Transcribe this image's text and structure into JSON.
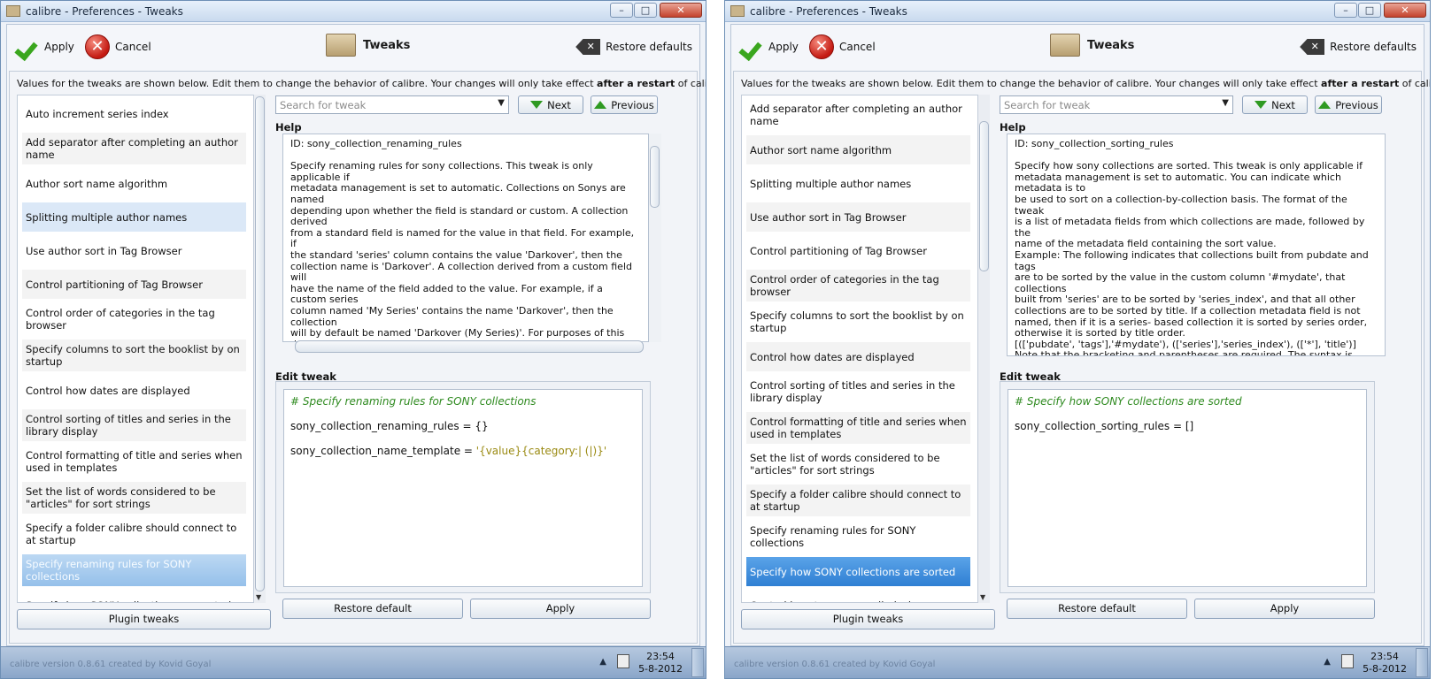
{
  "windows": [
    {
      "title": "calibre - Preferences - Tweaks",
      "toolbar": {
        "apply": "Apply",
        "cancel": "Cancel",
        "title": "Tweaks",
        "restore": "Restore defaults"
      },
      "description": {
        "before": "Values for the tweaks are shown below. Edit them to change the behavior of calibre. Your changes will only take effect ",
        "bold": "after a restart",
        "after": " of calibre."
      },
      "list": [
        "Auto increment series index",
        "Add separator after completing an author name",
        "Author sort name algorithm",
        "Splitting multiple author names",
        "Use author sort in Tag Browser",
        "Control partitioning of Tag Browser",
        "Control order of categories in the tag browser",
        "Specify columns to sort the booklist by on startup",
        "Control how dates are displayed",
        "Control sorting of titles and series in the library display",
        "Control formatting of title and series when used in templates",
        "Set the list of words considered to be \"articles\" for sort strings",
        "Specify a folder calibre should connect to at startup",
        "Specify renaming rules for SONY collections",
        "Specify how SONY collections are sorted"
      ],
      "search_placeholder": "Search for tweak",
      "next": "Next",
      "previous": "Previous",
      "help_label": "Help",
      "help_text": "ID: sony_collection_renaming_rules\n\nSpecify renaming rules for sony collections. This tweak is only applicable if\nmetadata management is set to automatic. Collections on Sonys are named\ndepending upon whether the field is standard or custom. A collection derived\nfrom a standard field is named for the value in that field. For example, if\nthe standard 'series' column contains the value 'Darkover', then the\ncollection name is 'Darkover'. A collection derived from a custom field will\nhave the name of the field added to the value. For example, if a custom series\ncolumn named 'My Series' contains the name 'Darkover', then the collection\nwill by default be named 'Darkover (My Series)'. For purposes of this\ndocumentation, 'Darkover' is called the value and 'My Series' is called the\ncategory. If two books have fields that generate the same collection name,\nthen both books will be in that collection.\nThis set of tweaks lets you specify for a standard or custom field how\nthe collections are to be named. You can use it to add a description to a\nstandard field, for example 'Foo (Tag)' instead of the 'Foo'. You can also use\nit to force multiple fields to end up in the same collection. For example, you",
      "edit_label": "Edit tweak",
      "edit_comment": "# Specify renaming rules for SONY collections",
      "edit_line1": "sony_collection_renaming_rules = {}",
      "edit_line2_code": "sony_collection_name_template = ",
      "edit_line2_str": "'{value}{category:| (|)}'",
      "plugin_tweaks": "Plugin tweaks",
      "restore_default": "Restore default",
      "apply": "Apply",
      "taskbar_status": "calibre version 0.8.61 created by Kovid Goyal",
      "clock_time": "23:54",
      "clock_date": "5-8-2012"
    },
    {
      "title": "calibre - Preferences - Tweaks",
      "toolbar": {
        "apply": "Apply",
        "cancel": "Cancel",
        "title": "Tweaks",
        "restore": "Restore defaults"
      },
      "description": {
        "before": "Values for the tweaks are shown below. Edit them to change the behavior of calibre. Your changes will only take effect ",
        "bold": "after a restart",
        "after": " of calibre."
      },
      "list": [
        "Add separator after completing an author name",
        "Author sort name algorithm",
        "Splitting multiple author names",
        "Use author sort in Tag Browser",
        "Control partitioning of Tag Browser",
        "Control order of categories in the tag browser",
        "Specify columns to sort the booklist by on startup",
        "Control how dates are displayed",
        "Control sorting of titles and series in the library display",
        "Control formatting of title and series when used in templates",
        "Set the list of words considered to be \"articles\" for sort strings",
        "Specify a folder calibre should connect to at startup",
        "Specify renaming rules for SONY collections",
        "Specify how SONY collections are sorted",
        "Control how tags are applied when"
      ],
      "search_placeholder": "Search for tweak",
      "next": "Next",
      "previous": "Previous",
      "help_label": "Help",
      "help_text": "ID: sony_collection_sorting_rules\n\nSpecify how sony collections are sorted. This tweak is only applicable if\nmetadata management is set to automatic. You can indicate which metadata is to\nbe used to sort on a collection-by-collection basis. The format of the tweak\nis a list of metadata fields from which collections are made, followed by the\nname of the metadata field containing the sort value.\nExample: The following indicates that collections built from pubdate and tags\nare to be sorted by the value in the custom column '#mydate', that collections\nbuilt from 'series' are to be sorted by 'series_index', and that all other\ncollections are to be sorted by title. If a collection metadata field is not\nnamed, then if it is a series- based collection it is sorted by series order,\notherwise it is sorted by title order.\n[(['pubdate', 'tags'],'#mydate'), (['series'],'series_index'), (['*'], 'title')]\nNote that the bracketing and parentheses are required. The syntax is\n[ ( [list of fields], sort field ) , ( [ list of fields ] , sort field ) ]\nDefault: empty (no rules), so no collection attributes are named.",
      "edit_label": "Edit tweak",
      "edit_comment": "# Specify how SONY collections are sorted",
      "edit_line1": "sony_collection_sorting_rules = []",
      "edit_line2_code": "",
      "edit_line2_str": "",
      "plugin_tweaks": "Plugin tweaks",
      "restore_default": "Restore default",
      "apply": "Apply",
      "taskbar_status": "calibre version 0.8.61 created by Kovid Goyal",
      "clock_time": "23:54",
      "clock_date": "5-8-2012"
    }
  ]
}
